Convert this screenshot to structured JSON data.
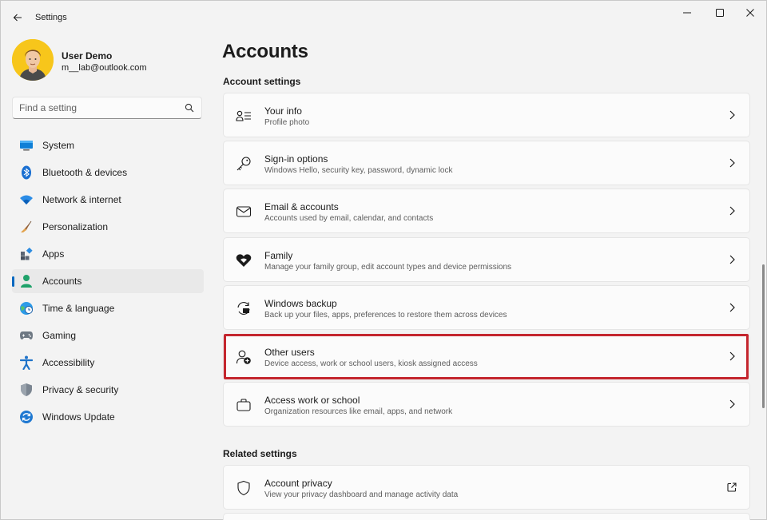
{
  "window": {
    "title": "Settings"
  },
  "profile": {
    "name": "User Demo",
    "email": "m__lab@outlook.com"
  },
  "search": {
    "placeholder": "Find a setting"
  },
  "sidebar": {
    "items": [
      {
        "label": "System",
        "icon": "system-icon"
      },
      {
        "label": "Bluetooth & devices",
        "icon": "bluetooth-icon"
      },
      {
        "label": "Network & internet",
        "icon": "wifi-icon"
      },
      {
        "label": "Personalization",
        "icon": "brush-icon"
      },
      {
        "label": "Apps",
        "icon": "apps-icon"
      },
      {
        "label": "Accounts",
        "icon": "accounts-icon",
        "selected": true
      },
      {
        "label": "Time & language",
        "icon": "globe-clock-icon"
      },
      {
        "label": "Gaming",
        "icon": "gamepad-icon"
      },
      {
        "label": "Accessibility",
        "icon": "accessibility-icon"
      },
      {
        "label": "Privacy & security",
        "icon": "shield-icon"
      },
      {
        "label": "Windows Update",
        "icon": "update-icon"
      }
    ]
  },
  "main": {
    "title": "Accounts",
    "account_settings_heading": "Account settings",
    "related_settings_heading": "Related settings",
    "cards": [
      {
        "title": "Your info",
        "subtitle": "Profile photo"
      },
      {
        "title": "Sign-in options",
        "subtitle": "Windows Hello, security key, password, dynamic lock"
      },
      {
        "title": "Email & accounts",
        "subtitle": "Accounts used by email, calendar, and contacts"
      },
      {
        "title": "Family",
        "subtitle": "Manage your family group, edit account types and device permissions"
      },
      {
        "title": "Windows backup",
        "subtitle": "Back up your files, apps, preferences to restore them across devices"
      },
      {
        "title": "Other users",
        "subtitle": "Device access, work or school users, kiosk assigned access"
      },
      {
        "title": "Access work or school",
        "subtitle": "Organization resources like email, apps, and network"
      }
    ],
    "related_cards": [
      {
        "title": "Account privacy",
        "subtitle": "View your privacy dashboard and manage activity data"
      }
    ]
  },
  "colors": {
    "accent": "#0067c0",
    "highlight": "#c4262e",
    "background": "#f3f3f3"
  }
}
